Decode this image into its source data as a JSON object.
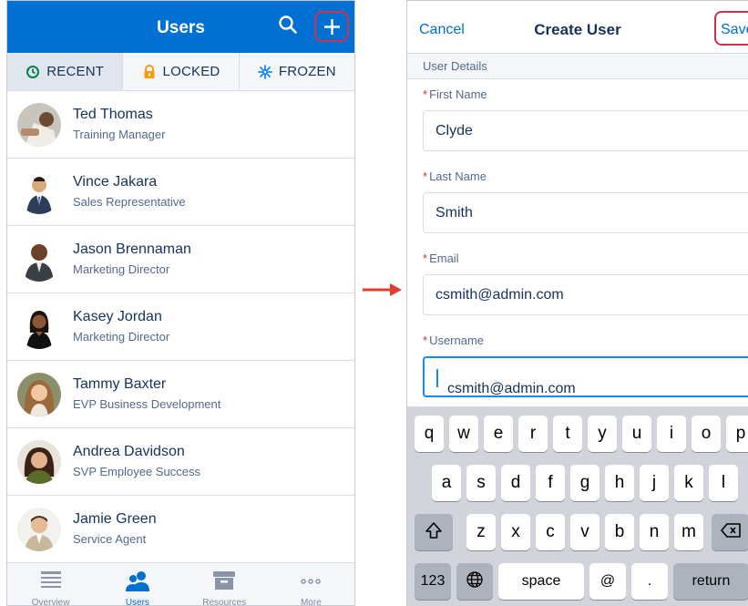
{
  "left": {
    "header_title": "Users",
    "tabs": [
      {
        "label": "RECENT",
        "icon": "clock-icon",
        "active": true
      },
      {
        "label": "LOCKED",
        "icon": "lock-icon",
        "active": false
      },
      {
        "label": "FROZEN",
        "icon": "snowflake-icon",
        "active": false
      }
    ],
    "users": [
      {
        "name": "Ted Thomas",
        "role": "Training Manager"
      },
      {
        "name": "Vince Jakara",
        "role": "Sales Representative"
      },
      {
        "name": "Jason Brennaman",
        "role": "Marketing Director"
      },
      {
        "name": "Kasey Jordan",
        "role": "Marketing Director"
      },
      {
        "name": "Tammy Baxter",
        "role": "EVP Business Development"
      },
      {
        "name": "Andrea Davidson",
        "role": "SVP Employee Success"
      },
      {
        "name": "Jamie Green",
        "role": "Service Agent"
      }
    ],
    "bottom_nav": [
      {
        "label": "Overview",
        "icon": "overview-icon"
      },
      {
        "label": "Users",
        "icon": "users-icon"
      },
      {
        "label": "Resources",
        "icon": "archive-icon"
      },
      {
        "label": "More",
        "icon": "more-icon"
      }
    ]
  },
  "right": {
    "cancel": "Cancel",
    "title": "Create User",
    "save": "Save",
    "section": "User Details",
    "required_mark": "*",
    "fields": [
      {
        "label": "First Name",
        "value": "Clyde"
      },
      {
        "label": "Last Name",
        "value": "Smith"
      },
      {
        "label": "Email",
        "value": "csmith@admin.com"
      },
      {
        "label": "Username",
        "value": "csmith@admin.com"
      }
    ],
    "keyboard": {
      "row1": [
        "q",
        "w",
        "e",
        "r",
        "t",
        "y",
        "u",
        "i",
        "o",
        "p"
      ],
      "row2": [
        "a",
        "s",
        "d",
        "f",
        "g",
        "h",
        "j",
        "k",
        "l"
      ],
      "row3": [
        "z",
        "x",
        "c",
        "v",
        "b",
        "n",
        "m"
      ],
      "numbers": "123",
      "space": "space",
      "at": "@",
      "dot": ".",
      "return": "return"
    }
  },
  "colors": {
    "brand_blue": "#0070d2",
    "highlight_red": "#d0314a",
    "arrow_red": "#e03c31"
  }
}
